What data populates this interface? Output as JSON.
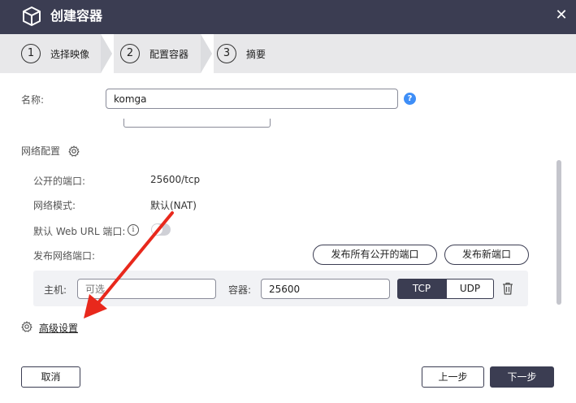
{
  "window": {
    "title": "创建容器"
  },
  "steps": [
    {
      "num": "1",
      "label": "选择映像"
    },
    {
      "num": "2",
      "label": "配置容器"
    },
    {
      "num": "3",
      "label": "摘要"
    }
  ],
  "form": {
    "name_label": "名称:",
    "name_value": "komga"
  },
  "network": {
    "section_title": "网络配置",
    "public_port_label": "公开的端口:",
    "public_port_value": "25600/tcp",
    "mode_label": "网络模式:",
    "mode_value": "默认(NAT)",
    "web_url_label": "默认 Web URL 端口:",
    "publish_label": "发布网络端口:",
    "publish_all_button": "发布所有公开的端口",
    "publish_new_button": "发布新端口",
    "host_label": "主机:",
    "host_placeholder": "可选",
    "container_label": "容器:",
    "container_value": "25600",
    "tcp_label": "TCP",
    "udp_label": "UDP",
    "selected_protocol": "TCP"
  },
  "advanced": {
    "label": "高级设置"
  },
  "footer": {
    "cancel": "取消",
    "prev": "上一步",
    "next": "下一步"
  },
  "colors": {
    "titlebar": "#3b3d52",
    "accent": "#3e8ef7",
    "annotation_arrow": "#e8281c"
  }
}
